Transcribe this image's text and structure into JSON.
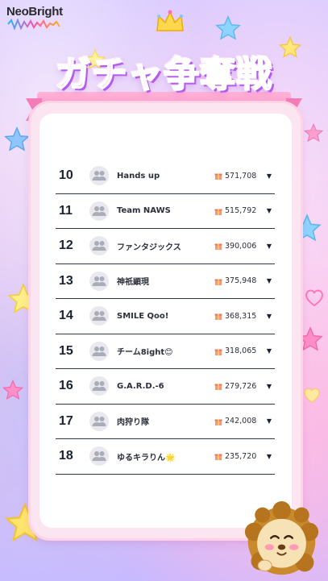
{
  "brand": {
    "logo_text": "NeoBright"
  },
  "header": {
    "title": "ガチャ争奪戦"
  },
  "ranking": {
    "rows": [
      {
        "rank": "10",
        "name": "Hands up",
        "score": "571,708"
      },
      {
        "rank": "11",
        "name": "Team NAWS",
        "score": "515,792"
      },
      {
        "rank": "12",
        "name": "ファンタジックス",
        "score": "390,006"
      },
      {
        "rank": "13",
        "name": "神祇顕現",
        "score": "375,948"
      },
      {
        "rank": "14",
        "name": "SMILE Qoo!",
        "score": "368,315"
      },
      {
        "rank": "15",
        "name": "チーム8ight😊",
        "score": "318,065"
      },
      {
        "rank": "16",
        "name": "G.A.R.D.-6",
        "score": "279,726"
      },
      {
        "rank": "17",
        "name": "肉狩り隊",
        "score": "242,008"
      },
      {
        "rank": "18",
        "name": "ゆるキラりん🌟",
        "score": "235,720"
      }
    ]
  },
  "icons": {
    "avatar": "group-avatar-icon",
    "gift": "gift-icon",
    "expand": "triangle-down-icon",
    "crown": "crown-icon",
    "mascot": "lion-mascot"
  },
  "colors": {
    "title_pink": "#ff5fb5",
    "title_outline": "#b45bf0",
    "divider": "#313844",
    "panel_border": "#fbe5f0"
  }
}
